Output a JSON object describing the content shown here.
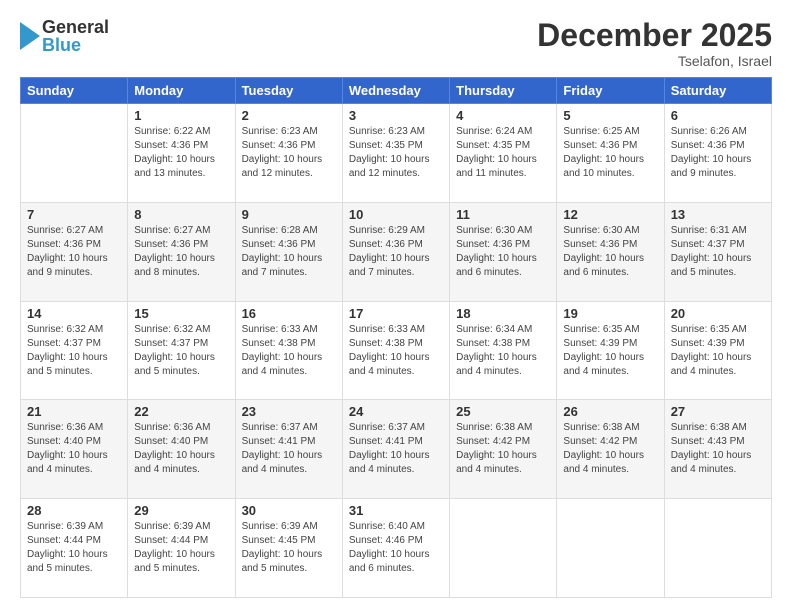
{
  "header": {
    "logo_general": "General",
    "logo_blue": "Blue",
    "month_title": "December 2025",
    "location": "Tselafon, Israel"
  },
  "days_of_week": [
    "Sunday",
    "Monday",
    "Tuesday",
    "Wednesday",
    "Thursday",
    "Friday",
    "Saturday"
  ],
  "weeks": [
    [
      {
        "day": "",
        "info": ""
      },
      {
        "day": "1",
        "info": "Sunrise: 6:22 AM\nSunset: 4:36 PM\nDaylight: 10 hours\nand 13 minutes."
      },
      {
        "day": "2",
        "info": "Sunrise: 6:23 AM\nSunset: 4:36 PM\nDaylight: 10 hours\nand 12 minutes."
      },
      {
        "day": "3",
        "info": "Sunrise: 6:23 AM\nSunset: 4:35 PM\nDaylight: 10 hours\nand 12 minutes."
      },
      {
        "day": "4",
        "info": "Sunrise: 6:24 AM\nSunset: 4:35 PM\nDaylight: 10 hours\nand 11 minutes."
      },
      {
        "day": "5",
        "info": "Sunrise: 6:25 AM\nSunset: 4:36 PM\nDaylight: 10 hours\nand 10 minutes."
      },
      {
        "day": "6",
        "info": "Sunrise: 6:26 AM\nSunset: 4:36 PM\nDaylight: 10 hours\nand 9 minutes."
      }
    ],
    [
      {
        "day": "7",
        "info": "Sunrise: 6:27 AM\nSunset: 4:36 PM\nDaylight: 10 hours\nand 9 minutes."
      },
      {
        "day": "8",
        "info": "Sunrise: 6:27 AM\nSunset: 4:36 PM\nDaylight: 10 hours\nand 8 minutes."
      },
      {
        "day": "9",
        "info": "Sunrise: 6:28 AM\nSunset: 4:36 PM\nDaylight: 10 hours\nand 7 minutes."
      },
      {
        "day": "10",
        "info": "Sunrise: 6:29 AM\nSunset: 4:36 PM\nDaylight: 10 hours\nand 7 minutes."
      },
      {
        "day": "11",
        "info": "Sunrise: 6:30 AM\nSunset: 4:36 PM\nDaylight: 10 hours\nand 6 minutes."
      },
      {
        "day": "12",
        "info": "Sunrise: 6:30 AM\nSunset: 4:36 PM\nDaylight: 10 hours\nand 6 minutes."
      },
      {
        "day": "13",
        "info": "Sunrise: 6:31 AM\nSunset: 4:37 PM\nDaylight: 10 hours\nand 5 minutes."
      }
    ],
    [
      {
        "day": "14",
        "info": "Sunrise: 6:32 AM\nSunset: 4:37 PM\nDaylight: 10 hours\nand 5 minutes."
      },
      {
        "day": "15",
        "info": "Sunrise: 6:32 AM\nSunset: 4:37 PM\nDaylight: 10 hours\nand 5 minutes."
      },
      {
        "day": "16",
        "info": "Sunrise: 6:33 AM\nSunset: 4:38 PM\nDaylight: 10 hours\nand 4 minutes."
      },
      {
        "day": "17",
        "info": "Sunrise: 6:33 AM\nSunset: 4:38 PM\nDaylight: 10 hours\nand 4 minutes."
      },
      {
        "day": "18",
        "info": "Sunrise: 6:34 AM\nSunset: 4:38 PM\nDaylight: 10 hours\nand 4 minutes."
      },
      {
        "day": "19",
        "info": "Sunrise: 6:35 AM\nSunset: 4:39 PM\nDaylight: 10 hours\nand 4 minutes."
      },
      {
        "day": "20",
        "info": "Sunrise: 6:35 AM\nSunset: 4:39 PM\nDaylight: 10 hours\nand 4 minutes."
      }
    ],
    [
      {
        "day": "21",
        "info": "Sunrise: 6:36 AM\nSunset: 4:40 PM\nDaylight: 10 hours\nand 4 minutes."
      },
      {
        "day": "22",
        "info": "Sunrise: 6:36 AM\nSunset: 4:40 PM\nDaylight: 10 hours\nand 4 minutes."
      },
      {
        "day": "23",
        "info": "Sunrise: 6:37 AM\nSunset: 4:41 PM\nDaylight: 10 hours\nand 4 minutes."
      },
      {
        "day": "24",
        "info": "Sunrise: 6:37 AM\nSunset: 4:41 PM\nDaylight: 10 hours\nand 4 minutes."
      },
      {
        "day": "25",
        "info": "Sunrise: 6:38 AM\nSunset: 4:42 PM\nDaylight: 10 hours\nand 4 minutes."
      },
      {
        "day": "26",
        "info": "Sunrise: 6:38 AM\nSunset: 4:42 PM\nDaylight: 10 hours\nand 4 minutes."
      },
      {
        "day": "27",
        "info": "Sunrise: 6:38 AM\nSunset: 4:43 PM\nDaylight: 10 hours\nand 4 minutes."
      }
    ],
    [
      {
        "day": "28",
        "info": "Sunrise: 6:39 AM\nSunset: 4:44 PM\nDaylight: 10 hours\nand 5 minutes."
      },
      {
        "day": "29",
        "info": "Sunrise: 6:39 AM\nSunset: 4:44 PM\nDaylight: 10 hours\nand 5 minutes."
      },
      {
        "day": "30",
        "info": "Sunrise: 6:39 AM\nSunset: 4:45 PM\nDaylight: 10 hours\nand 5 minutes."
      },
      {
        "day": "31",
        "info": "Sunrise: 6:40 AM\nSunset: 4:46 PM\nDaylight: 10 hours\nand 6 minutes."
      },
      {
        "day": "",
        "info": ""
      },
      {
        "day": "",
        "info": ""
      },
      {
        "day": "",
        "info": ""
      }
    ]
  ]
}
